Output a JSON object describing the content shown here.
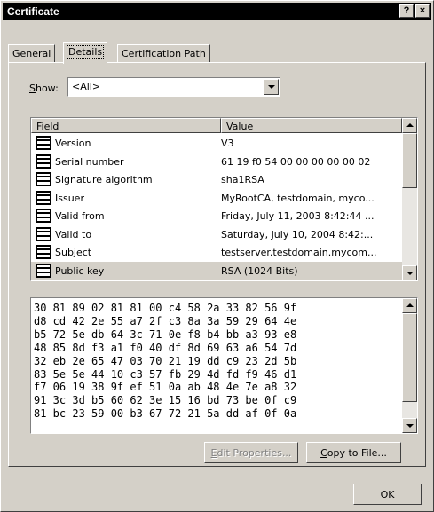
{
  "window": {
    "title": "Certificate",
    "help_button": "?",
    "close_button": "×"
  },
  "tabs": [
    {
      "label": "General",
      "active": false
    },
    {
      "label": "Details",
      "active": true
    },
    {
      "label": "Certification Path",
      "active": false
    }
  ],
  "show": {
    "label_accesskey": "S",
    "label_rest": "how:",
    "value": "<All>"
  },
  "fields_table": {
    "columns": [
      "Field",
      "Value"
    ],
    "rows": [
      {
        "field": "Version",
        "value": "V3",
        "icon": "field-icon"
      },
      {
        "field": "Serial number",
        "value": "61 19 f0 54 00 00 00 00 00 02",
        "icon": "field-icon"
      },
      {
        "field": "Signature algorithm",
        "value": "sha1RSA",
        "icon": "field-icon"
      },
      {
        "field": "Issuer",
        "value": "MyRootCA, testdomain, myco...",
        "icon": "field-icon"
      },
      {
        "field": "Valid from",
        "value": "Friday, July 11, 2003 8:42:44 ...",
        "icon": "field-icon"
      },
      {
        "field": "Valid to",
        "value": "Saturday, July 10, 2004 8:42:...",
        "icon": "field-icon"
      },
      {
        "field": "Subject",
        "value": "testserver.testdomain.mycom...",
        "icon": "field-icon"
      },
      {
        "field": "Public key",
        "value": "RSA (1024 Bits)",
        "icon": "field-icon",
        "selected": true
      }
    ]
  },
  "hex_dump": {
    "lines": [
      "30 81 89 02 81 81 00 c4 58 2a 33 82 56 9f",
      "d8 cd 42 2e 55 a7 2f c3 8a 3a 59 29 64 4e",
      "b5 72 5e db 64 3c 71 0e f8 b4 bb a3 93 e8",
      "48 85 8d f3 a1 f0 40 df 8d 69 63 a6 54 7d",
      "32 eb 2e 65 47 03 70 21 19 dd c9 23 2d 5b",
      "83 5e 5e 44 10 c3 57 fb 29 4d fd f9 46 d1",
      "f7 06 19 38 9f ef 51 0a ab 48 4e 7e a8 32",
      "91 3c 3d b5 60 62 3e 15 16 bd 73 be 0f c9",
      "81 bc 23 59 00 b3 67 72 21 5a dd af 0f 0a"
    ]
  },
  "buttons": {
    "edit_properties": {
      "accesskey": "E",
      "rest": "dit Properties...",
      "enabled": false
    },
    "copy_to_file": {
      "accesskey": "C",
      "rest": "opy to File...",
      "enabled": true
    },
    "ok": "OK"
  }
}
